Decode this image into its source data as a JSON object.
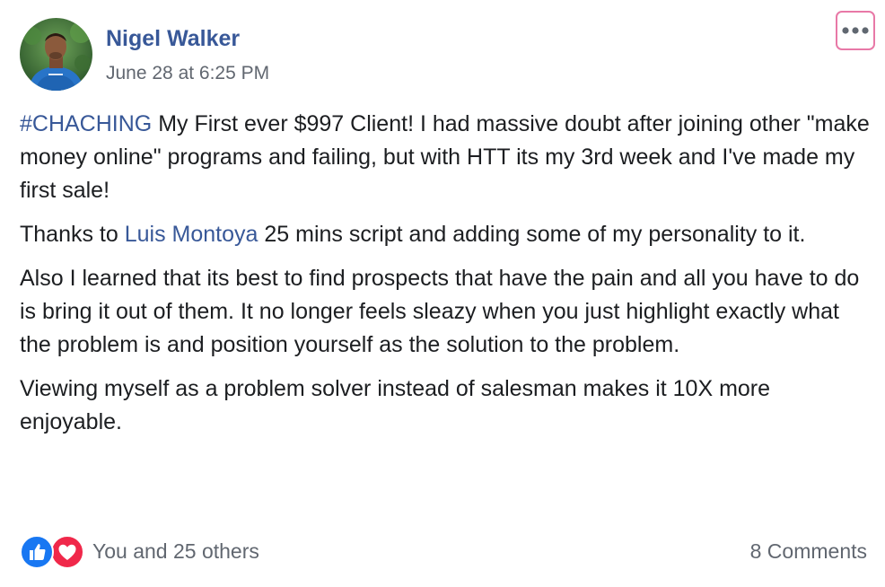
{
  "post": {
    "author": "Nigel Walker",
    "timestamp": "June 28 at 6:25 PM",
    "more_icon": "more-options-icon",
    "paragraphs": [
      {
        "hashtag": "#CHACHING",
        "text": " My First ever $997 Client! I had massive doubt after joining other \"make money online\" programs and failing, but with HTT its my 3rd week and I've made my first sale!"
      },
      {
        "prefix": "Thanks to ",
        "mention": "Luis Montoya",
        "suffix": " 25 mins script and adding some of my personality to it."
      },
      {
        "text": "Also I learned that its best to find prospects that have the pain and all you have to do is bring it out of them. It no longer feels sleazy when you just highlight exactly what the problem is and position yourself as the solution to the problem."
      },
      {
        "text": "Viewing myself as a problem solver instead of salesman makes it 10X more enjoyable."
      }
    ]
  },
  "footer": {
    "reactions": [
      "like-icon",
      "love-icon"
    ],
    "reaction_summary": "You and 25 others",
    "comments": "8 Comments"
  },
  "colors": {
    "link": "#385898",
    "text": "#1c1e21",
    "meta": "#616770",
    "like": "#1877f2",
    "love": "#f0284a",
    "focus_outline": "#e879a7"
  }
}
